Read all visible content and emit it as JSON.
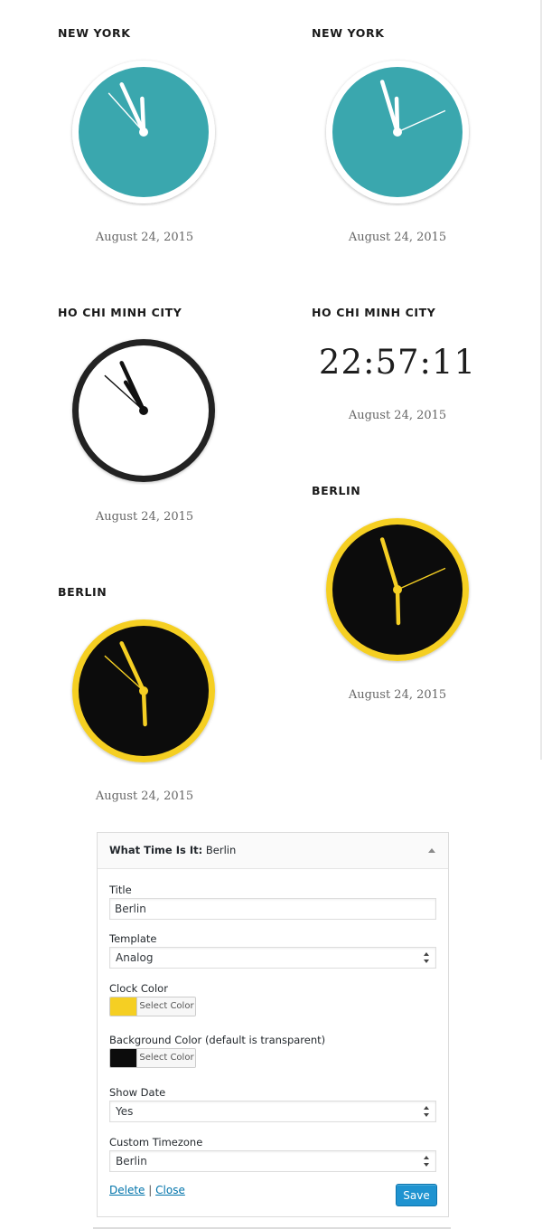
{
  "widgets": [
    {
      "title": "NEW YORK",
      "date": "August 24, 2015",
      "type": "analog",
      "face": "#3aa7ae",
      "ring": "#ffffff",
      "hands": "#ffffff",
      "time": "11:55:53"
    },
    {
      "title": "NEW YORK",
      "date": "August 24, 2015",
      "type": "analog",
      "face": "#3aa7ae",
      "ring": "#ffffff",
      "hands": "#ffffff",
      "time": "11:57:11"
    },
    {
      "title": "HO CHI MINH CITY",
      "date": "August 24, 2015",
      "type": "analog",
      "face": "#ffffff",
      "ring": "#222222",
      "hands": "#111111",
      "time": "10:55:52"
    },
    {
      "title": "HO CHI MINH CITY",
      "date": "August 24, 2015",
      "type": "digital",
      "digital_time": "22:57:11"
    },
    {
      "title": "BERLIN",
      "date": "August 24, 2015",
      "type": "analog",
      "face": "#0c0c0c",
      "ring": "#f5cf23",
      "hands": "#f5cf23",
      "time": "5:57:11"
    },
    {
      "title": "BERLIN",
      "date": "August 24, 2015",
      "type": "analog",
      "face": "#0c0c0c",
      "ring": "#f5cf23",
      "hands": "#f5cf23",
      "time": "5:55:52"
    }
  ],
  "panel": {
    "widget_name": "What Time Is It:",
    "widget_instance": "Berlin",
    "title_label": "Title",
    "title_value": "Berlin",
    "template_label": "Template",
    "template_value": "Analog",
    "clock_color_label": "Clock Color",
    "clock_color": "#f5cf23",
    "select_color_label": "Select Color",
    "bg_color_label": "Background Color (default is transparent)",
    "bg_color": "#0c0c0c",
    "show_date_label": "Show Date",
    "show_date_value": "Yes",
    "timezone_label": "Custom Timezone",
    "timezone_value": "Berlin",
    "delete_label": "Delete",
    "separator": "|",
    "close_label": "Close",
    "save_label": "Save"
  }
}
